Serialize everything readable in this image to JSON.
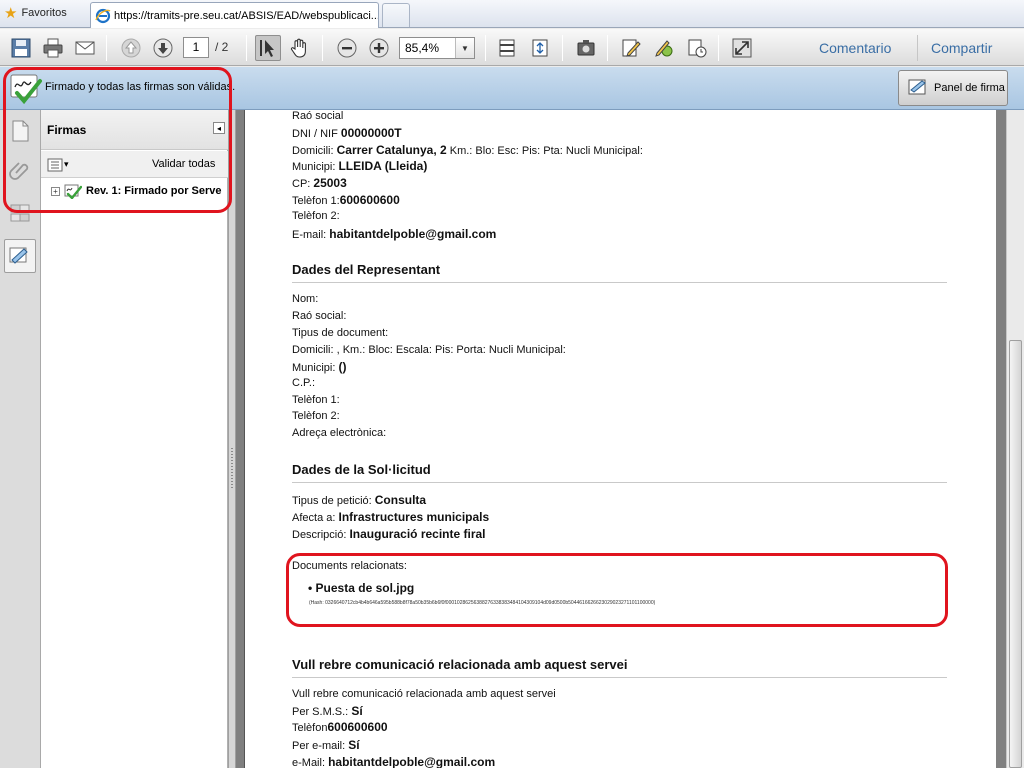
{
  "browser": {
    "favorites_label": "Favoritos",
    "tab_url": "https://tramits-pre.seu.cat/ABSIS/EAD/webspublicaci..."
  },
  "toolbar": {
    "page_current": "1",
    "page_total": "/ 2",
    "zoom": "85,4%",
    "comment_label": "Comentario",
    "share_label": "Compartir"
  },
  "signature_bar": {
    "status": "Firmado y todas las firmas son válidas.",
    "panel_button": "Panel de firma"
  },
  "signatures_panel": {
    "title": "Firmas",
    "validate_all": "Validar todas",
    "revision": "Rev. 1: Firmado por Serve"
  },
  "document": {
    "applicant": {
      "rao_social_label": "Raó social",
      "dni_label": "DNI / NIF",
      "dni_value": "00000000T",
      "domicili_label": "Domicili:",
      "domicili_value": "Carrer Catalunya, 2",
      "domicili_rest": "Km.:   Blo:  Esc:  Pis:  Pta:  Nucli Municipal:",
      "municipi_label": "Municipi:",
      "municipi_value": "LLEIDA (Lleida)",
      "cp_label": "CP:",
      "cp_value": "25003",
      "tel1_label": "Telèfon 1:",
      "tel1_value": "600600600",
      "tel2_label": "Telèfon 2:",
      "email_label": "E-mail:",
      "email_value": "habitantdelpoble@gmail.com"
    },
    "representative": {
      "heading": "Dades del Representant",
      "nom": "Nom:",
      "rao_social": "Raó social:",
      "tipus_doc": "Tipus de document:",
      "domicili": "Domicili:  ,     Km.:    Bloc: Escala: Pis:  Porta:  Nucli Municipal:",
      "municipi_label": "Municipi:",
      "municipi_value": "()",
      "cp": "C.P.:",
      "tel1": "Telèfon 1:",
      "tel2": "Telèfon 2:",
      "adreca": "Adreça electrònica:"
    },
    "request": {
      "heading": "Dades de la Sol·licitud",
      "tipus_label": "Tipus de petició:",
      "tipus_value": "Consulta",
      "afecta_label": "Afecta a:",
      "afecta_value": "Infrastructures municipals",
      "descripcio_label": "Descripció:",
      "descripcio_value": "Inauguració recinte firal",
      "docs_label": "Documents relacionats:",
      "doc_name": "Puesta de sol.jpg",
      "doc_hash": "(Hash: 0326640712cb4b4b646a595b588b8f78a50b35b6b6f0f00010286256388276338383484104309104d09d0500b5044616626623029023271101100000)"
    },
    "communication": {
      "heading": "Vull rebre comunicació relacionada amb aquest servei",
      "intro": "Vull rebre comunicació relacionada amb aquest servei",
      "sms_label": "Per S.M.S.:",
      "sms_value": "Sí",
      "tel_label": "Telèfon",
      "tel_value": "600600600",
      "email_label": "Per e-mail:",
      "email_value": "Sí",
      "email_addr_label": "e-Mail:",
      "email_addr_value": "habitantdelpoble@gmail.com"
    }
  },
  "colors": {
    "annotation": "#e0141e",
    "signature_bar": "#b5cfe7",
    "link": "#3a6ea5"
  }
}
